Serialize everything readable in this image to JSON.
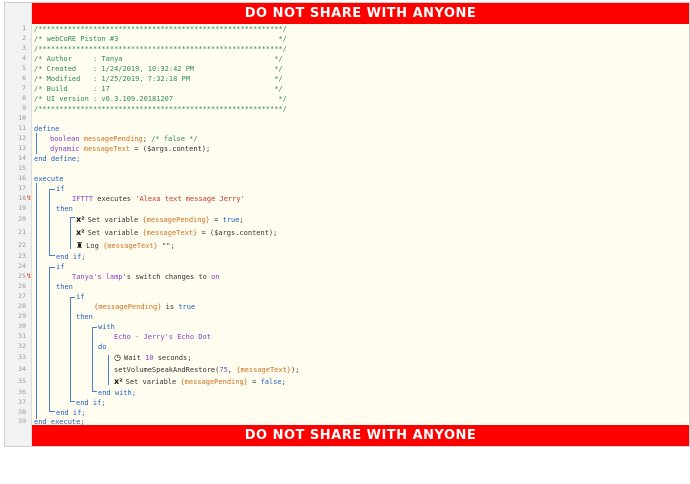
{
  "banner": {
    "top": "DO NOT SHARE WITH ANYONE",
    "bottom": "DO NOT SHARE WITH ANYONE"
  },
  "gutter": {
    "line_numbers": [
      "1",
      "2",
      "3",
      "4",
      "5",
      "6",
      "7",
      "8",
      "9",
      "10",
      "11",
      "12",
      "13",
      "14",
      "15",
      "16",
      "17",
      "18",
      "19",
      "20",
      "21",
      "22",
      "23",
      "24",
      "25",
      "26",
      "27",
      "28",
      "29",
      "30",
      "31",
      "32",
      "33",
      "34",
      "35",
      "36",
      "37",
      "38",
      "39"
    ],
    "condition_marker": "↯"
  },
  "header": {
    "rule": "/**********************************************************/",
    "title": "/* webCoRE Piston #3                                      */",
    "author": "/* Author     : Tanya                                    */",
    "created": "/* Created    : 1/24/2019, 10:32:42 PM                   */",
    "modified": "/* Modified   : 1/25/2019, 7:32:18 PM                    */",
    "build": "/* Build      : 17                                       */",
    "ui_version": "/* UI version : v0.3.109.20181207                         */"
  },
  "code": {
    "define": "define",
    "var1_type": "boolean",
    "var1_name": "messagePending",
    "var1_comment": "/* false */",
    "var2_type": "dynamic",
    "var2_name": "messageText",
    "var2_value": "($args.content)",
    "end_define": "end define;",
    "execute": "execute",
    "if": "if",
    "then": "then",
    "end_if": "end if;",
    "ifttt": "IFTTT",
    "executes": "executes",
    "ifttt_event": "'Alexa text message Jerry'",
    "set_variable": "Set variable",
    "sv1_var": "{messagePending}",
    "sv1_val": "true",
    "sv2_var": "{messageText}",
    "sv2_val": "($args.content)",
    "log": "Log",
    "log_arg": "{messageText}",
    "log_tail": "\"\";",
    "device_lamp": "Tanya's lamp",
    "switch_text": "'s switch changes to",
    "on": "on",
    "cond_var": "{messagePending}",
    "is": "is",
    "true": "true",
    "with": "with",
    "echo_device": "Echo - Jerry's Echo Dot",
    "do": "do",
    "wait": "Wait",
    "wait_num": "10",
    "wait_unit": "seconds;",
    "speak_fn": "setVolumeSpeakAndRestore(",
    "speak_vol": "75",
    "speak_arg": "{messageText}",
    "speak_end": ");",
    "sv3_var": "{messagePending}",
    "sv3_val": "false",
    "end_with": "end with;",
    "end_execute": "end execute;",
    "eq": "=",
    "semi": ";",
    "comma": ", "
  },
  "icons": {
    "variable": "x²",
    "log": "♜",
    "wait": "◷"
  }
}
